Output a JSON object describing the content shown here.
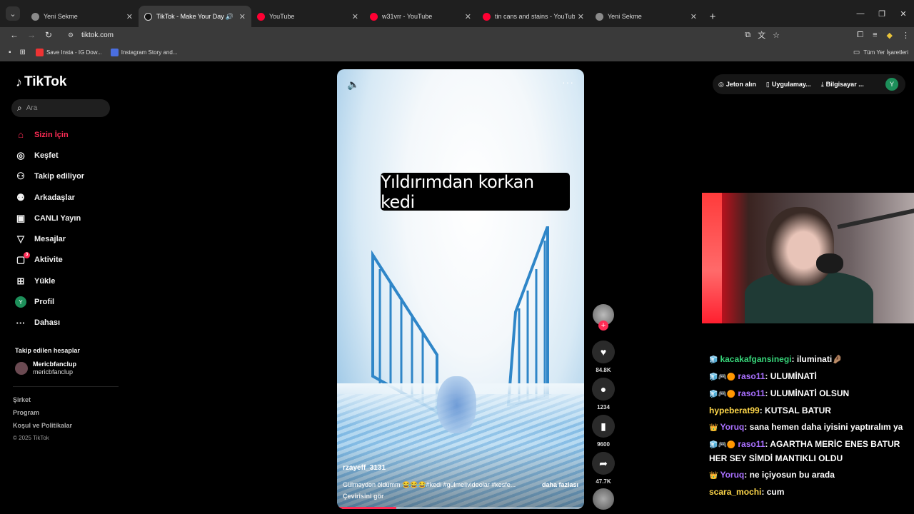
{
  "browser": {
    "tabs": [
      {
        "title": "Yeni Sekme",
        "icon": "chrome-icon",
        "active": false
      },
      {
        "title": "TikTok - Make Your Day",
        "icon": "tiktok-icon",
        "active": true,
        "audio": true
      },
      {
        "title": "YouTube",
        "icon": "youtube-icon",
        "active": false
      },
      {
        "title": "w31vrr - YouTube",
        "icon": "youtube-icon",
        "active": false
      },
      {
        "title": "tin cans and stains - YouTube",
        "icon": "youtube-icon",
        "active": false
      },
      {
        "title": "Yeni Sekme",
        "icon": "chrome-icon",
        "active": false
      }
    ],
    "url": "tiktok.com",
    "bookmarks": [
      {
        "label": "Save Insta - IG Dow...",
        "color": "#e33"
      },
      {
        "label": "Instagram Story and...",
        "color": "#4a6ee0"
      }
    ],
    "bookmarks_right": "Tüm Yer İşaretleri"
  },
  "tiktok": {
    "logo": "TikTok",
    "search_placeholder": "Ara",
    "nav": [
      {
        "label": "Sizin İçin",
        "icon": "home-icon",
        "glyph": "⌂",
        "active": true
      },
      {
        "label": "Keşfet",
        "icon": "compass-icon",
        "glyph": "◎"
      },
      {
        "label": "Takip ediliyor",
        "icon": "following-icon",
        "glyph": "⚇"
      },
      {
        "label": "Arkadaşlar",
        "icon": "friends-icon",
        "glyph": "⚉"
      },
      {
        "label": "CANLI Yayın",
        "icon": "live-icon",
        "glyph": "▣"
      },
      {
        "label": "Mesajlar",
        "icon": "messages-icon",
        "glyph": "▽"
      },
      {
        "label": "Aktivite",
        "icon": "activity-icon",
        "glyph": "▢",
        "badge": "3"
      },
      {
        "label": "Yükle",
        "icon": "upload-icon",
        "glyph": "⊞"
      },
      {
        "label": "Profil",
        "icon": "profile-avatar",
        "glyph": "Y"
      },
      {
        "label": "Dahası",
        "icon": "more-icon",
        "glyph": "···"
      }
    ],
    "following_header": "Takip edilen hesaplar",
    "following_account": {
      "name": "Mericbfanclup",
      "handle": "mericbfanclup"
    },
    "footer": [
      "Şirket",
      "Program",
      "Koşul ve Politikalar",
      "© 2025 TikTok"
    ],
    "top_actions": {
      "coins": "Jeton alın",
      "app": "Uygulamay...",
      "desktop": "Bilgisayar ...",
      "avatar_letter": "Y"
    },
    "video": {
      "overlay_text": "Yıldırımdan korkan kedi",
      "author": "rzayeff_3131",
      "description": "Gülməydən öldümm 😂😂😂#kedi #gülmelivideolar #kesfe...",
      "more": "daha fazlası",
      "translation": "Çevirisini gör",
      "progress": 0.24
    },
    "counts": {
      "likes": "84.8K",
      "comments": "1234",
      "saves": "9600",
      "shares": "47.7K"
    }
  },
  "chat": [
    {
      "badges": "🧊",
      "user": "kacakafgansinegi",
      "color": "#37d67a",
      "text": ": iluminati🤌🏽"
    },
    {
      "badges": "🧊🎮🟠",
      "user": "raso11",
      "color": "#a970ff",
      "text": ": ULUMİNATİ"
    },
    {
      "badges": "🧊🎮🟠",
      "user": "raso11",
      "color": "#a970ff",
      "text": ": ULUMİNATİ OLSUN"
    },
    {
      "badges": "",
      "user": "hypeberat99",
      "color": "#ffd84a",
      "text": ": KUTSAL BATUR"
    },
    {
      "badges": "👑",
      "user": "Yoruq",
      "color": "#a970ff",
      "text": ": sana hemen daha iyisini yaptıralım ya"
    },
    {
      "badges": "🧊🎮🟠",
      "user": "raso11",
      "color": "#a970ff",
      "text": ": AGARTHA MERİC ENES BATUR HER SEY SİMDİ MANTIKLI OLDU"
    },
    {
      "badges": "👑",
      "user": "Yoruq",
      "color": "#a970ff",
      "text": ": ne içiyosun bu arada"
    },
    {
      "badges": "",
      "user": "scara_mochi",
      "color": "#ffd84a",
      "text": ": cum"
    }
  ]
}
